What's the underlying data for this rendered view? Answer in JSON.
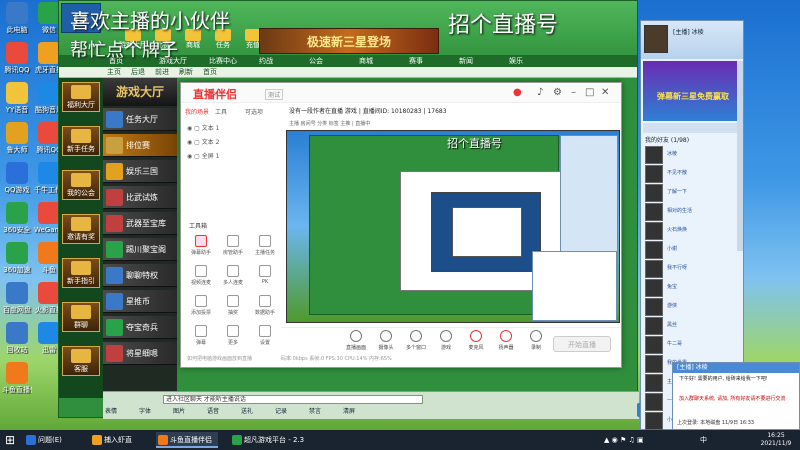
{
  "overlay": {
    "title_line1": "喜欢主播的小伙伴",
    "title_line2": "帮忙点个牌子",
    "right_text": "招个直播号"
  },
  "desktop_icons": [
    {
      "label": "此电脑",
      "color": "#3a78c8"
    },
    {
      "label": "微信",
      "color": "#2aa24a"
    },
    {
      "label": "腾讯QQ",
      "color": "#e94a3b"
    },
    {
      "label": "虎牙直播",
      "color": "#f0a020"
    },
    {
      "label": "YY语音",
      "color": "#f2c43b"
    },
    {
      "label": "酷狗音乐",
      "color": "#1e88e5"
    },
    {
      "label": "鲁大师",
      "color": "#e2a21f"
    },
    {
      "label": "腾讯QQ",
      "color": "#e94a3b"
    },
    {
      "label": "QQ游戏",
      "color": "#2b6fd8"
    },
    {
      "label": "千牛工作台",
      "color": "#1e88e5"
    },
    {
      "label": "360安全",
      "color": "#2aa24a"
    },
    {
      "label": "WeGame",
      "color": "#e94a3b"
    },
    {
      "label": "360加速",
      "color": "#2aa24a"
    },
    {
      "label": "斗鱼",
      "color": "#f07a1b"
    },
    {
      "label": "百度网盘",
      "color": "#3a78c8"
    },
    {
      "label": "火影直播",
      "color": "#e94a3b"
    },
    {
      "label": "回收站",
      "color": "#3a78c8"
    },
    {
      "label": "迅雷",
      "color": "#1e88e5"
    },
    {
      "label": "斗鱼直播伴侣",
      "color": "#f07a1b"
    }
  ],
  "main_window": {
    "logo": "J5",
    "top_tabs": [
      {
        "label": "游戏大厅"
      },
      {
        "label": "比赛"
      },
      {
        "label": "商城"
      },
      {
        "label": "任务"
      },
      {
        "label": "充值"
      }
    ],
    "banner": "极速新三星登场",
    "nav": [
      "首页",
      "游戏大厅",
      "比赛中心",
      "约战",
      "公会",
      "商城",
      "赛事",
      "新闻",
      "娱乐"
    ],
    "subnav": [
      "主页",
      "后退",
      "前进",
      "刷新",
      "首页"
    ],
    "left_col": [
      {
        "label": "福利大厅"
      },
      {
        "label": "新手任务"
      },
      {
        "label": "我的公会"
      },
      {
        "label": "邀请有奖"
      },
      {
        "label": "新手指引"
      },
      {
        "label": "群聊"
      },
      {
        "label": "客服"
      }
    ],
    "games_head": "游戏大厅",
    "games": [
      {
        "label": "任务大厅",
        "color": "#3a78c8",
        "selected": false
      },
      {
        "label": "排位赛",
        "color": "#c8a040",
        "selected": true
      },
      {
        "label": "娱乐三国",
        "color": "#e2a21f",
        "selected": false
      },
      {
        "label": "比武试炼",
        "color": "#c04040",
        "selected": false
      },
      {
        "label": "武器至宝库",
        "color": "#c04040",
        "selected": false
      },
      {
        "label": "踢川聚宝阁",
        "color": "#2aa24a",
        "selected": false
      },
      {
        "label": "聊聊特权",
        "color": "#3a78c8",
        "selected": false
      },
      {
        "label": "星推币",
        "color": "#3a78c8",
        "selected": false
      },
      {
        "label": "夺宝奇兵",
        "color": "#2aa24a",
        "selected": false
      },
      {
        "label": "将星细嗯",
        "color": "#c04040",
        "selected": false
      }
    ],
    "chat_input": "进入社区聊天 才能听主播说话",
    "chat_tools": [
      "表情",
      "字体",
      "图片",
      "语音",
      "送礼",
      "记录",
      "禁言",
      "清屏"
    ],
    "send_label": "发送"
  },
  "stream_window": {
    "logo": "直播伴侣",
    "badge": "测试",
    "tabs": [
      "我的场景",
      "工具",
      "可选项"
    ],
    "info_bar": "没有一段作者在直播  游戏  |  直播间ID: 10180283  |  17683",
    "stats_bar": "主播  房间号  分类  标签  主推  |  直播中",
    "scenes": [
      "文本 1",
      "文本 2",
      "全屏 1"
    ],
    "tools_title": "工具箱",
    "tools": [
      {
        "label": "弹幕助手",
        "red": true
      },
      {
        "label": "房管助手",
        "red": false
      },
      {
        "label": "主播任务",
        "red": false
      },
      {
        "label": "视频连麦",
        "red": false
      },
      {
        "label": "多人连麦",
        "red": false
      },
      {
        "label": "PK",
        "red": false
      },
      {
        "label": "添加投票",
        "red": false
      },
      {
        "label": "抽奖",
        "red": false
      },
      {
        "label": "数据助手",
        "red": false
      },
      {
        "label": "弹幕",
        "red": false
      },
      {
        "label": "更多",
        "red": false
      },
      {
        "label": "设置",
        "red": false
      }
    ],
    "bottom_tools": [
      {
        "label": "直播画面",
        "red": false
      },
      {
        "label": "摄像头",
        "red": false
      },
      {
        "label": "多个窗口",
        "red": false
      },
      {
        "label": "游戏",
        "red": false
      },
      {
        "label": "麦克风",
        "red": true
      },
      {
        "label": "扬声器",
        "red": true
      },
      {
        "label": "录制",
        "red": false
      }
    ],
    "start_label": "开始直播",
    "tip": "如何把电脑游戏画面放到直播",
    "status": "码率:0kbps  丢帧:0  FPS:30  CPU:14%  内存:65%",
    "preview_title": "招个直播号"
  },
  "right_panel": {
    "name": "[主播] 冰棱",
    "ad_text": "弹幕新三星免费赢取",
    "group_title": "我的好友 (1/98)",
    "members": [
      "冰棱",
      "不见不散",
      "了解一下",
      "相对的生活",
      "火石焕焕",
      "小谢",
      "我不行呀",
      "兔宝",
      "游侠",
      "黑丝",
      "牛二哥",
      "我的世界",
      "主播",
      "一大波",
      "小号"
    ]
  },
  "chat_popup": {
    "head": "[主播] 冰棱",
    "msg1": "下午好! 需要的用户, 给砖来给我一下吧!",
    "msg2": "加入群聊天系统, 请加, 所有好友请不要进行交流",
    "foot": "上次登录: 本地磁盘  11/9日 16:33"
  },
  "taskbar": {
    "items": [
      {
        "label": "问题(E)",
        "color": "#2b6fd8",
        "active": false
      },
      {
        "label": "捕入虾直",
        "color": "#f0a020",
        "active": false
      },
      {
        "label": "斗鱼直播伴侣",
        "color": "#f07a1b",
        "active": true
      },
      {
        "label": "超凡游戏平台 - 2.3",
        "color": "#2aa24a",
        "active": false
      }
    ],
    "time": "16:25",
    "date": "2021/11/9",
    "lang": "中"
  }
}
